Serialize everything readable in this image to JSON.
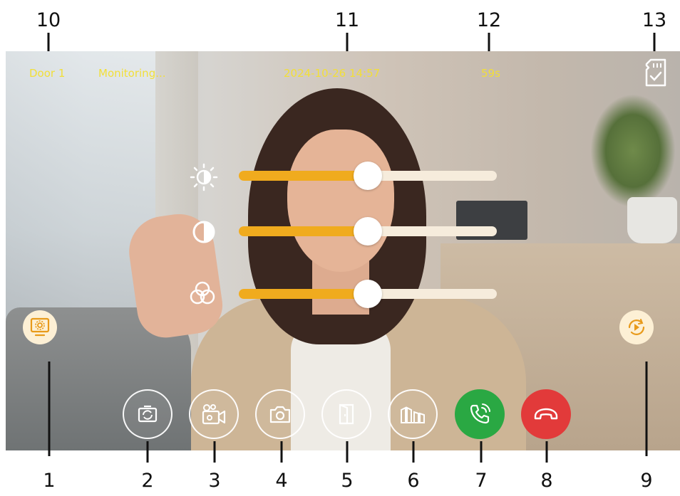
{
  "callouts": {
    "n1": "1",
    "n2": "2",
    "n3": "3",
    "n4": "4",
    "n5": "5",
    "n6": "6",
    "n7": "7",
    "n8": "8",
    "n9": "9",
    "n10": "10",
    "n11": "11",
    "n12": "12",
    "n13": "13"
  },
  "status": {
    "door": "Door 1",
    "mode": "Monitoring...",
    "datetime": "2024-10-26  14:57",
    "timer": "59s"
  },
  "adjust": {
    "brightness_level": 0.5,
    "contrast_level": 0.5,
    "color_level": 0.5
  },
  "icons": {
    "sd": "sd-card-check-icon",
    "brightness": "brightness-icon",
    "contrast": "contrast-icon",
    "color": "color-saturation-icon",
    "settings": "monitor-settings-icon",
    "switch": "switch-camera-icon",
    "record": "record-video-icon",
    "snapshot": "snapshot-camera-icon",
    "unlock": "door-unlock-icon",
    "gate": "gate-icon",
    "answer": "phone-answer-icon",
    "hangup": "phone-hangup-icon",
    "playback": "playback-icon"
  },
  "colors": {
    "status_text": "#f2df38",
    "slider_fill": "#f0ab1e",
    "answer": "#2aa843",
    "hangup": "#e23a3a"
  }
}
